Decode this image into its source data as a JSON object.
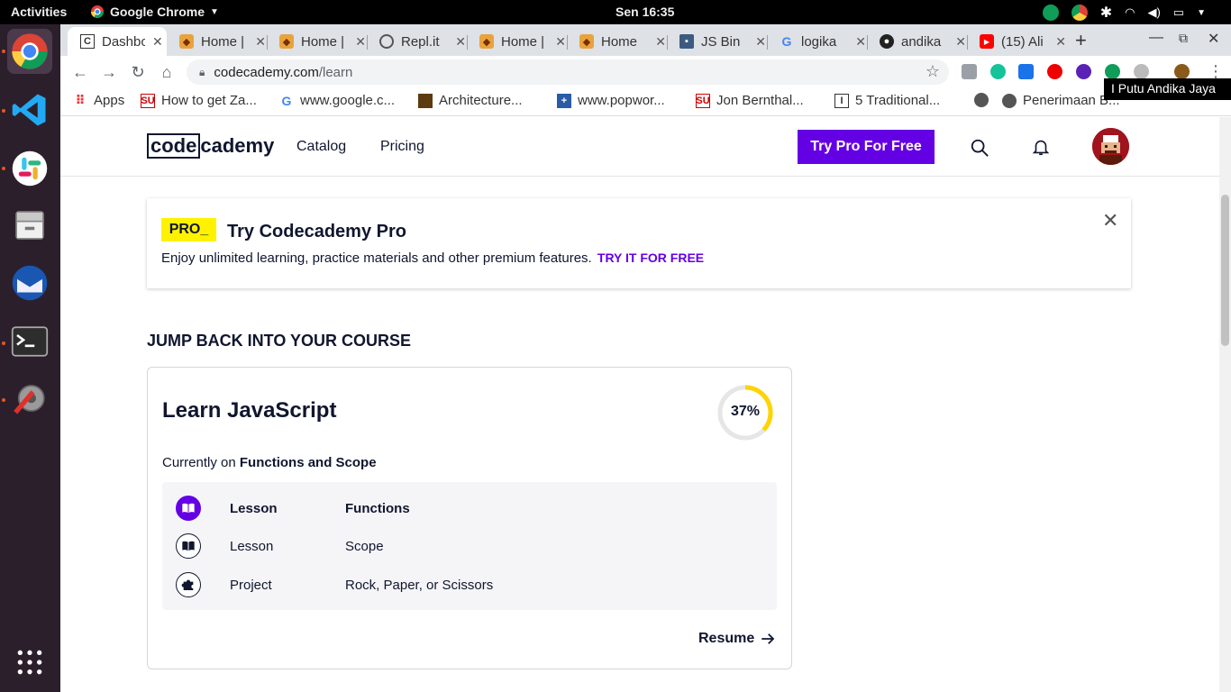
{
  "system": {
    "activities": "Activities",
    "app_name": "Google Chrome",
    "clock": "Sen 16:35"
  },
  "browser": {
    "tabs": [
      {
        "title": "Dashbo",
        "icon": "codecademy-icon",
        "active": true
      },
      {
        "title": "Home |",
        "icon": "gitlab-fox-icon"
      },
      {
        "title": "Home |",
        "icon": "gitlab-fox-icon"
      },
      {
        "title": "Repl.it",
        "icon": "replit-icon"
      },
      {
        "title": "Home |",
        "icon": "gitlab-fox-icon"
      },
      {
        "title": "Home",
        "icon": "gitlab-fox-icon"
      },
      {
        "title": "JS Bin",
        "icon": "jsbin-icon"
      },
      {
        "title": "logika",
        "icon": "google-icon"
      },
      {
        "title": "andika",
        "icon": "github-icon"
      },
      {
        "title": "(15) Ali",
        "icon": "youtube-icon"
      }
    ],
    "url_host": "codecademy.com",
    "url_path": "/learn",
    "bookmarks": [
      {
        "label": "Apps",
        "icon": "apps-grid-icon"
      },
      {
        "label": "How to get Za...",
        "icon": "bookmark-su-icon"
      },
      {
        "label": "www.google.c...",
        "icon": "google-icon"
      },
      {
        "label": "Architecture...",
        "icon": "book-icon"
      },
      {
        "label": "www.popwor...",
        "icon": "popworld-icon"
      },
      {
        "label": "Jon Bernthal...",
        "icon": "bookmark-su-icon"
      },
      {
        "label": "5 Traditional...",
        "icon": "instructables-icon"
      },
      {
        "label": "",
        "icon": "globe-icon"
      },
      {
        "label": "Penerimaan B...",
        "icon": "globe-icon"
      }
    ],
    "profile_tooltip": "I Putu Andika Jaya"
  },
  "site": {
    "logo_box": "code",
    "logo_rest": "cademy",
    "nav": {
      "catalog": "Catalog",
      "pricing": "Pricing"
    },
    "try_pro": "Try Pro For Free"
  },
  "pro_banner": {
    "badge": "PRO_",
    "title": "Try Codecademy Pro",
    "description": "Enjoy unlimited learning, practice materials and other premium features.",
    "link": "TRY IT FOR FREE"
  },
  "course": {
    "section_title": "JUMP BACK INTO YOUR COURSE",
    "title": "Learn JavaScript",
    "progress_label": "37%",
    "progress_value": 0.37,
    "current_prefix": "Currently on",
    "current_topic": "Functions and Scope",
    "items": [
      {
        "type": "Lesson",
        "name": "Functions",
        "icon": "book-open-icon",
        "current": true
      },
      {
        "type": "Lesson",
        "name": "Scope",
        "icon": "book-open-icon"
      },
      {
        "type": "Project",
        "name": "Rock, Paper, or Scissors",
        "icon": "puzzle-icon"
      }
    ],
    "resume": "Resume"
  },
  "colors": {
    "brand_purple": "#6400e4",
    "pro_yellow": "#fff200",
    "progress_yellow": "#ffd300",
    "navy": "#10162f"
  }
}
